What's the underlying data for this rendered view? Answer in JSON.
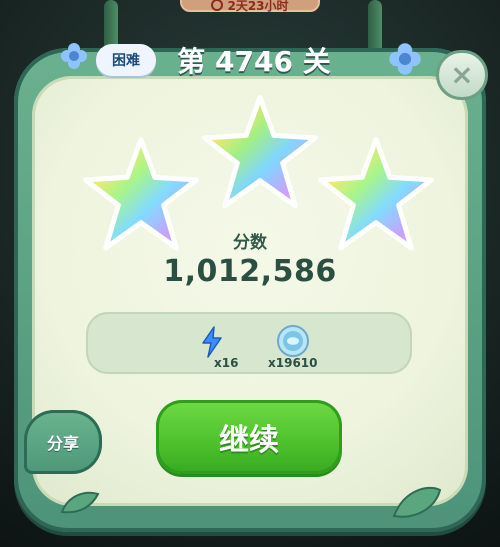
{
  "header": {
    "timer_text": "2天23小时"
  },
  "title": {
    "difficulty": "困难",
    "level": "第 4746 关"
  },
  "score": {
    "label": "分数",
    "value": "1,012,586"
  },
  "rewards": [
    {
      "icon": "lightning-icon",
      "count": "x16"
    },
    {
      "icon": "coin-icon",
      "count": "x19610"
    }
  ],
  "actions": {
    "continue_label": "继续",
    "share_label": "分享",
    "close_symbol": "×"
  },
  "stars": {
    "earned": 3,
    "total": 3
  },
  "colors": {
    "panel_green": "#4d937a",
    "cream": "#eef4de",
    "continue_green": "#4cc12c"
  }
}
